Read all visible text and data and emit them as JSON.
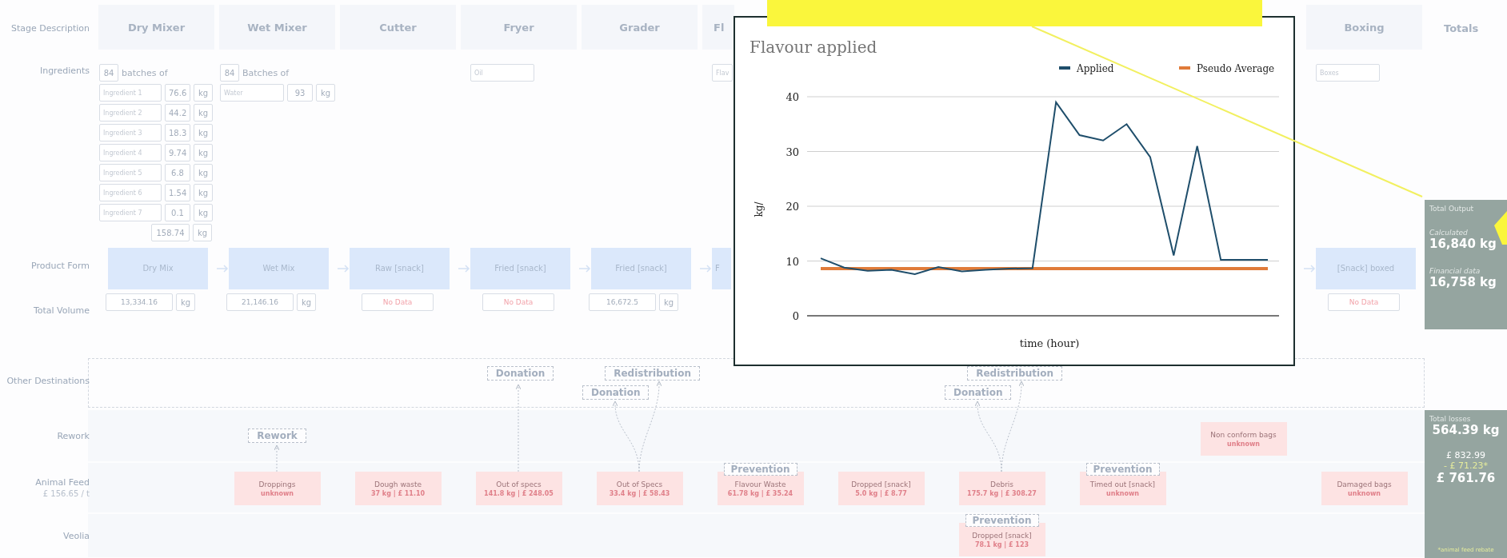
{
  "labels": {
    "stage_description": "Stage Description",
    "ingredients": "Ingredients",
    "product_form": "Product Form",
    "total_volume": "Total Volume",
    "other_destinations": "Other Destinations",
    "rework": "Rework",
    "animal_feed": "Animal Feed",
    "animal_feed_price": "£ 156.65 / t",
    "veolia": "Veolia"
  },
  "stages": [
    {
      "name": "Dry Mixer",
      "covered": false,
      "batches": {
        "count": "84",
        "label": "batches of"
      },
      "ingredients": [
        {
          "placeholder": "Ingredient 1",
          "amount": "76.6",
          "unit": "kg"
        },
        {
          "placeholder": "Ingredient 2",
          "amount": "44.2",
          "unit": "kg"
        },
        {
          "placeholder": "Ingredient 3",
          "amount": "18.3",
          "unit": "kg"
        },
        {
          "placeholder": "Ingredient 4",
          "amount": "9.74",
          "unit": "kg"
        },
        {
          "placeholder": "Ingredient 5",
          "amount": "6.8",
          "unit": "kg"
        },
        {
          "placeholder": "Ingredient 6",
          "amount": "1.54",
          "unit": "kg"
        },
        {
          "placeholder": "Ingredient 7",
          "amount": "0.1",
          "unit": "kg"
        }
      ],
      "ingredients_total": {
        "amount": "158.74",
        "unit": "kg"
      },
      "product_form": "Dry Mix",
      "total_volume": {
        "kind": "measured",
        "value": "13,334.16",
        "unit": "kg"
      }
    },
    {
      "name": "Wet Mixer",
      "covered": false,
      "batches": {
        "count": "84",
        "label": "Batches of"
      },
      "ingredients": [
        {
          "placeholder": "Water",
          "amount": "93",
          "unit": "kg"
        }
      ],
      "product_form": "Wet Mix",
      "total_volume": {
        "kind": "measured",
        "value": "21,146.16",
        "unit": "kg"
      },
      "rework": {
        "kind": "tag",
        "text": "Rework"
      },
      "animal_feed": {
        "title": "Droppings",
        "detail": "unknown"
      }
    },
    {
      "name": "Cutter",
      "covered": false,
      "product_form": "Raw [snack]",
      "total_volume": {
        "kind": "missing",
        "value": "No Data"
      },
      "animal_feed": {
        "title": "Dough waste",
        "detail": "37 kg | £ 11.10"
      }
    },
    {
      "name": "Fryer",
      "covered": false,
      "ingredients": [
        {
          "placeholder": "Oil"
        }
      ],
      "product_form": "Fried [snack]",
      "total_volume": {
        "kind": "missing",
        "value": "No Data"
      },
      "destinations": [
        "Donation"
      ],
      "animal_feed": {
        "title": "Out of specs",
        "detail": "141.8 kg | £ 248.05"
      }
    },
    {
      "name": "Grader",
      "covered": false,
      "product_form": "Fried [snack]",
      "total_volume": {
        "kind": "measured",
        "value": "16,672.5",
        "unit": "kg"
      },
      "destinations": [
        "Redistribution",
        "Donation"
      ],
      "animal_feed": {
        "title": "Out of Specs",
        "detail": "33.4 kg | £ 58.43"
      }
    },
    {
      "name": "Fl",
      "covered": true,
      "ingredients": [
        {
          "placeholder": "Flav"
        }
      ],
      "product_form": "F",
      "animal_feed": {
        "title": "Flavour Waste",
        "detail": "61.78 kg | £ 35.24",
        "tag": "Prevention"
      }
    },
    {
      "animal_feed": {
        "title": "Dropped [snack]",
        "detail": "5.0 kg | £ 8.77"
      }
    },
    {
      "destinations": [
        "Redistribution",
        "Donation"
      ],
      "animal_feed": {
        "title": "Debris",
        "detail": "175.7 kg | £ 308.27"
      },
      "veolia": {
        "title": "Dropped [snack]",
        "detail": "78.1 kg | £ 123",
        "tag": "Prevention"
      }
    },
    {
      "animal_feed": {
        "title": "Timed out [snack]",
        "detail": "unknown",
        "tag": "Prevention"
      }
    },
    {
      "rework": {
        "kind": "loss",
        "title": "Non conform bags",
        "detail": "unknown"
      }
    },
    {
      "name": "Boxing",
      "covered": false,
      "ingredients": [
        {
          "placeholder": "Boxes"
        }
      ],
      "product_form": "[Snack] boxed",
      "total_volume": {
        "kind": "missing",
        "value": "No Data"
      },
      "animal_feed": {
        "title": "Damaged bags",
        "detail": "unknown"
      }
    }
  ],
  "totals": {
    "header": "Totals",
    "output": {
      "title": "Total Output",
      "calculated_label": "Calculated",
      "calculated": "16,840 kg",
      "financial_label": "Financial data",
      "financial": "16,758 kg"
    },
    "losses": {
      "title": "Total losses",
      "mass": "564.39 kg",
      "gross": "£ 832.99",
      "rebate": "- £ 71.23*",
      "net": "£ 761.76",
      "footnote": "*animal feed rebate"
    }
  },
  "chart": {
    "chart_data": {
      "type": "line",
      "grid": true,
      "legend": true,
      "title": "Flavour applied",
      "xlabel": "time (hour)",
      "ylabel": "kg/",
      "ylim": [
        0,
        40
      ],
      "yticks": [
        0,
        10,
        20,
        30,
        40
      ],
      "series": [
        {
          "name": "Applied",
          "color": "#1f4e6b",
          "values": [
            10.5,
            8.8,
            8.2,
            8.4,
            7.6,
            8.9,
            8.1,
            8.4,
            8.6,
            8.7,
            39,
            33,
            32,
            35,
            29,
            11,
            31,
            10.2,
            10.2,
            10.2
          ]
        },
        {
          "name": "Pseudo Average",
          "color": "#e07b39",
          "values": [
            8.6,
            8.6,
            8.6,
            8.6,
            8.6,
            8.6,
            8.6,
            8.6,
            8.6,
            8.6,
            8.6,
            8.6,
            8.6,
            8.6,
            8.6,
            8.6,
            8.6,
            8.6,
            8.6,
            8.6
          ]
        }
      ]
    }
  }
}
